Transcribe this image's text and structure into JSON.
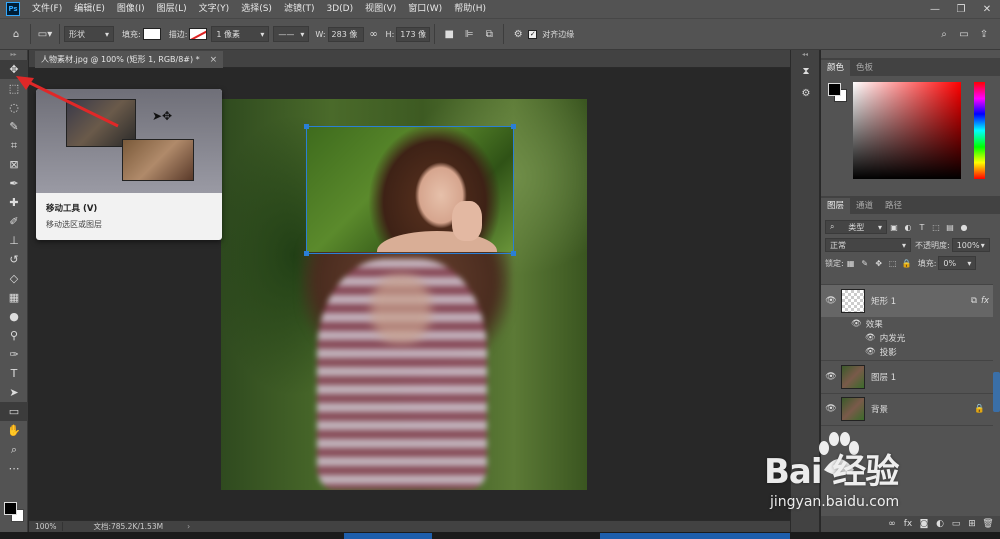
{
  "app": {
    "logo": "Ps"
  },
  "menu": [
    "文件(F)",
    "编辑(E)",
    "图像(I)",
    "图层(L)",
    "文字(Y)",
    "选择(S)",
    "滤镜(T)",
    "3D(D)",
    "视图(V)",
    "窗口(W)",
    "帮助(H)"
  ],
  "window_controls": {
    "minimize": "—",
    "restore": "❐",
    "close": "✕"
  },
  "options": {
    "mode": "形状",
    "fill_label": "填充:",
    "stroke_label": "描边:",
    "stroke_width": "1 像素",
    "w_label": "W:",
    "w_value": "283 像",
    "h_label": "H:",
    "h_value": "173 像",
    "align_edges": "对齐边缘"
  },
  "document": {
    "tab_title": "人物素材.jpg @ 100% (矩形 1, RGB/8#) *",
    "close": "×"
  },
  "tooltip": {
    "title": "移动工具 (V)",
    "description": "移动选区或图层"
  },
  "status": {
    "zoom": "100%",
    "doc": "文档:785.2K/1.53M",
    "arrow": "›"
  },
  "color_panel": {
    "tabs": [
      "颜色",
      "色板"
    ]
  },
  "layers_panel": {
    "tabs": [
      "图层",
      "通道",
      "路径"
    ],
    "filter_kind": "类型",
    "blend_mode": "正常",
    "opacity_label": "不透明度:",
    "opacity_value": "100%",
    "lock_label": "锁定:",
    "fill_label": "填充:",
    "fill_value": "0%",
    "layers": [
      {
        "name": "矩形 1",
        "fx": "fx"
      },
      {
        "name": "图层 1"
      },
      {
        "name": "背景"
      }
    ],
    "effects_label": "效果",
    "effect_glow": "内发光",
    "effect_shadow": "投影"
  },
  "watermark": {
    "brand": "Bai  经验",
    "url": "jingyan.baidu.com"
  },
  "colors": {
    "accent": "#2a7fd6",
    "arrow": "#e02828",
    "panel": "#535353"
  }
}
